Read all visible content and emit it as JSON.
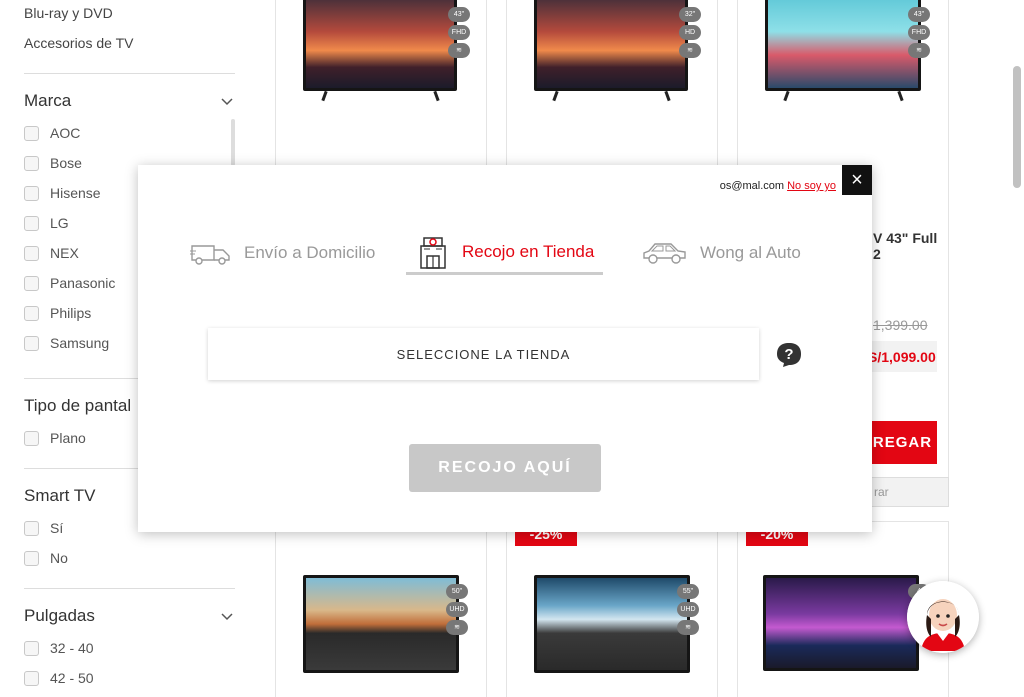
{
  "sidebar": {
    "categories": [
      "Blu-ray y DVD",
      "Accesorios de TV"
    ],
    "sections": [
      {
        "title": "Marca",
        "options": [
          "AOC",
          "Bose",
          "Hisense",
          "LG",
          "NEX",
          "Panasonic",
          "Philips",
          "Samsung"
        ]
      },
      {
        "title": "Tipo de pantal",
        "options": [
          "Plano"
        ]
      },
      {
        "title": "Smart TV",
        "options": [
          "Sí",
          "No"
        ]
      },
      {
        "title": "Pulgadas",
        "options": [
          "32 - 40",
          "42 - 50"
        ]
      }
    ]
  },
  "products": {
    "row1": [
      {
        "size_badge": "43\"",
        "res_badge": "FHD"
      },
      {
        "size_badge": "32\"",
        "res_badge": "HD"
      },
      {
        "size_badge": "43\"",
        "res_badge": "FHD",
        "name_partial_1": "V 43\" Full",
        "name_partial_2": "2",
        "old_price_partial": "1,399.00",
        "price_partial": "S/1,099.00",
        "cta_partial": "REGAR",
        "compare_partial": "rar"
      }
    ],
    "row2": [
      {
        "discount_partial": "",
        "size_badge": "50\"",
        "res_badge": "UHD"
      },
      {
        "discount_partial": "-25%",
        "size_badge": "55\"",
        "res_badge": "UHD"
      },
      {
        "discount_partial": "-20%",
        "size_badge": "4",
        "res_badge": ""
      }
    ]
  },
  "modal": {
    "user_email": "os@mal.com",
    "not_me_link": "No soy yo",
    "close_label": "×",
    "tabs": [
      {
        "label": "Envío a Domicilio",
        "icon": "truck-icon",
        "active": false
      },
      {
        "label": "Recojo en Tienda",
        "icon": "store-icon",
        "active": true
      },
      {
        "label": "Wong al Auto",
        "icon": "car-icon",
        "active": false
      }
    ],
    "store_select_label": "SELECCIONE LA TIENDA",
    "help_label": "?",
    "pickup_button": "RECOJO AQUÍ"
  },
  "colors": {
    "brand_red": "#e30613",
    "disabled": "#c8c8c8"
  }
}
